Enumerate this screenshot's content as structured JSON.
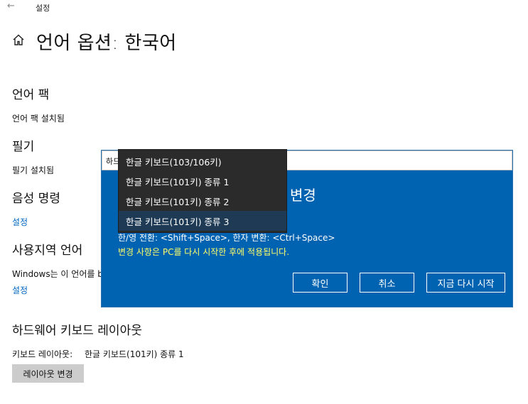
{
  "window": {
    "back_glyph": "←",
    "title": "설정"
  },
  "page": {
    "title": "언어 옵션: 한국어"
  },
  "sections": {
    "language_pack": {
      "heading": "언어 팩",
      "status": "언어 팩 설치됨"
    },
    "handwriting": {
      "heading": "필기",
      "status": "필기 설치됨"
    },
    "speech": {
      "heading": "음성 명령",
      "link": "설정"
    },
    "regional": {
      "heading": "사용지역 언어",
      "text": "Windows는 이 언어를 b",
      "link": "설정"
    },
    "hardware_keyboard": {
      "heading": "하드웨어 키보드 레이아웃",
      "layout_label": "키보드 레이아웃:",
      "layout_value": "한글 키보드(101키) 종류 1",
      "change_button": "레이아웃 변경"
    }
  },
  "dialog": {
    "input_value": "하드",
    "title": "변경",
    "hint": "한/영 전환: <Shift+Space>, 한자 변환: <Ctrl+Space>",
    "note": "변경 사항은 PC를 다시 시작한 후에 적용됩니다.",
    "ok_button": "확인",
    "cancel_button": "취소",
    "restart_button": "지금 다시 시작",
    "colors": {
      "background": "#0063b1",
      "note": "#ffff66"
    }
  },
  "dropdown": {
    "options": [
      "한글 키보드(103/106키)",
      "한글 키보드(101키) 종류 1",
      "한글 키보드(101키) 종류 2",
      "한글 키보드(101키) 종류 3"
    ],
    "selected_index": 3
  },
  "icons": {
    "back": "back-arrow-icon",
    "home": "home-icon"
  }
}
